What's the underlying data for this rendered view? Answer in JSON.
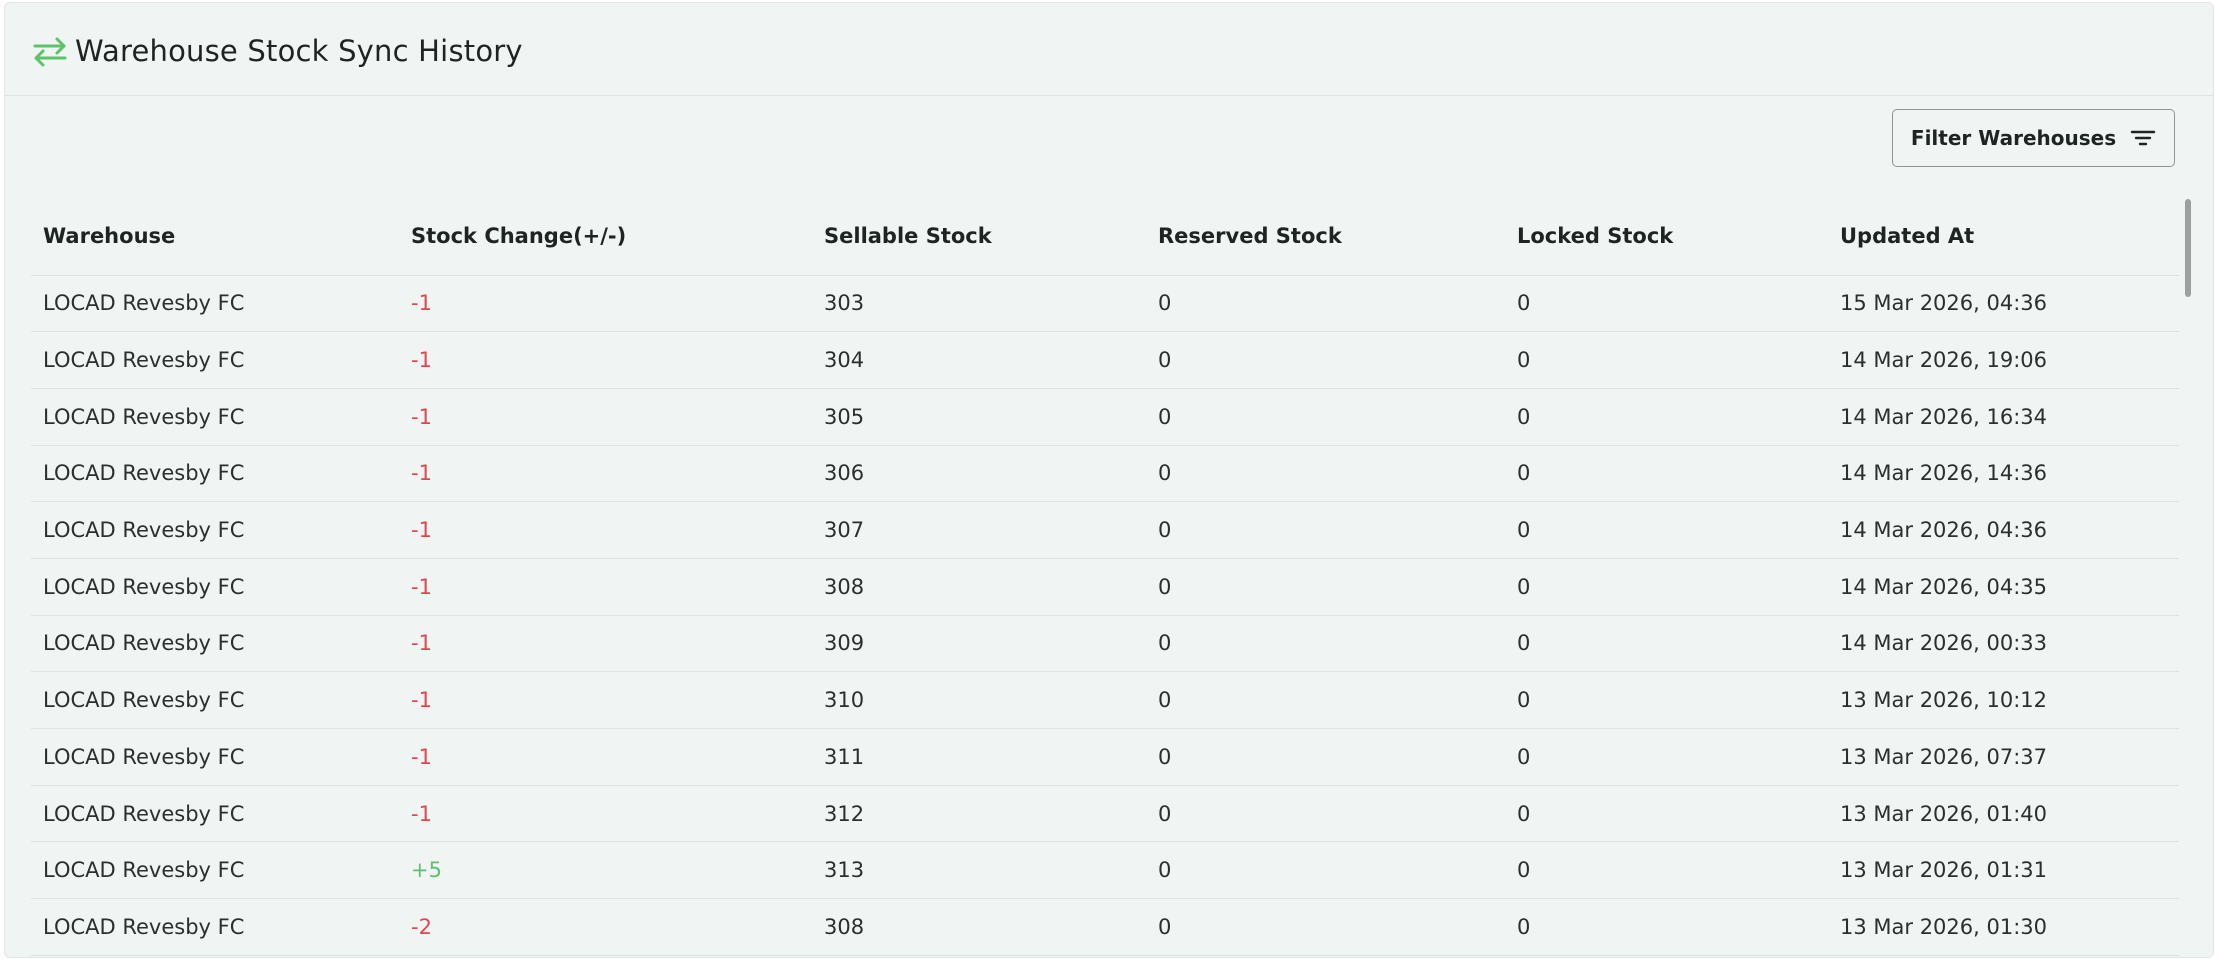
{
  "header": {
    "title": "Warehouse Stock Sync History",
    "icon": "sync-arrows-icon",
    "icon_color": "#5cc36a"
  },
  "filter": {
    "label": "Filter Warehouses",
    "icon": "filter-lines-icon"
  },
  "table": {
    "columns": [
      "Warehouse",
      "Stock Change(+/-)",
      "Sellable Stock",
      "Reserved Stock",
      "Locked Stock",
      "Updated At"
    ],
    "rows": [
      {
        "warehouse": "LOCAD Revesby FC",
        "change": "-1",
        "sellable": "303",
        "reserved": "0",
        "locked": "0",
        "updated": "15 Mar 2026, 04:36"
      },
      {
        "warehouse": "LOCAD Revesby FC",
        "change": "-1",
        "sellable": "304",
        "reserved": "0",
        "locked": "0",
        "updated": "14 Mar 2026, 19:06"
      },
      {
        "warehouse": "LOCAD Revesby FC",
        "change": "-1",
        "sellable": "305",
        "reserved": "0",
        "locked": "0",
        "updated": "14 Mar 2026, 16:34"
      },
      {
        "warehouse": "LOCAD Revesby FC",
        "change": "-1",
        "sellable": "306",
        "reserved": "0",
        "locked": "0",
        "updated": "14 Mar 2026, 14:36"
      },
      {
        "warehouse": "LOCAD Revesby FC",
        "change": "-1",
        "sellable": "307",
        "reserved": "0",
        "locked": "0",
        "updated": "14 Mar 2026, 04:36"
      },
      {
        "warehouse": "LOCAD Revesby FC",
        "change": "-1",
        "sellable": "308",
        "reserved": "0",
        "locked": "0",
        "updated": "14 Mar 2026, 04:35"
      },
      {
        "warehouse": "LOCAD Revesby FC",
        "change": "-1",
        "sellable": "309",
        "reserved": "0",
        "locked": "0",
        "updated": "14 Mar 2026, 00:33"
      },
      {
        "warehouse": "LOCAD Revesby FC",
        "change": "-1",
        "sellable": "310",
        "reserved": "0",
        "locked": "0",
        "updated": "13 Mar 2026, 10:12"
      },
      {
        "warehouse": "LOCAD Revesby FC",
        "change": "-1",
        "sellable": "311",
        "reserved": "0",
        "locked": "0",
        "updated": "13 Mar 2026, 07:37"
      },
      {
        "warehouse": "LOCAD Revesby FC",
        "change": "-1",
        "sellable": "312",
        "reserved": "0",
        "locked": "0",
        "updated": "13 Mar 2026, 01:40"
      },
      {
        "warehouse": "LOCAD Revesby FC",
        "change": "+5",
        "sellable": "313",
        "reserved": "0",
        "locked": "0",
        "updated": "13 Mar 2026, 01:31"
      },
      {
        "warehouse": "LOCAD Revesby FC",
        "change": "-2",
        "sellable": "308",
        "reserved": "0",
        "locked": "0",
        "updated": "13 Mar 2026, 01:30"
      }
    ]
  },
  "colors": {
    "negative": "#e0474c",
    "positive": "#5cc36a",
    "background": "#f0f4f3"
  }
}
